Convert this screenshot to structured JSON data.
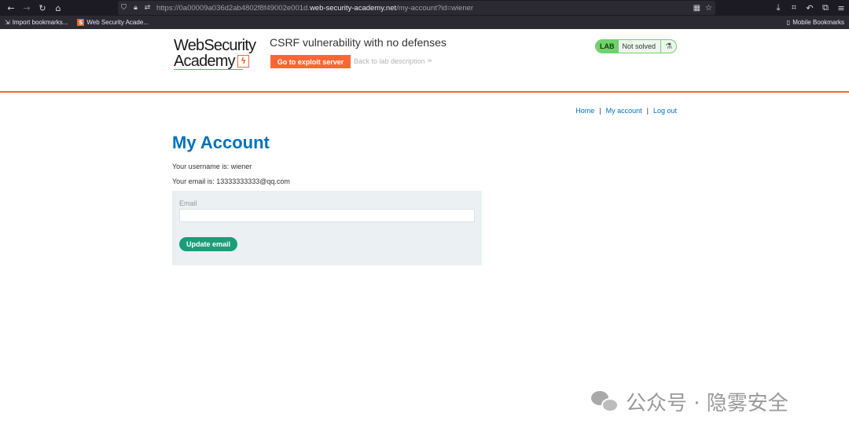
{
  "browser": {
    "url_prefix": "https://0a00009a036d2ab4802f8f49002e001d.",
    "url_host": "web-security-academy.net",
    "url_path": "/my-account?id=wiener",
    "bookmarks": [
      {
        "label": "Import bookmarks..."
      },
      {
        "label": "Web Security Acade..."
      }
    ],
    "mobile_bookmarks": "Mobile Bookmarks"
  },
  "header": {
    "logo_line1": "WebSecurity",
    "logo_line2": "Academy",
    "lab_title": "CSRF vulnerability with no defenses",
    "exploit_button": "Go to exploit server",
    "back_link": "Back to lab description",
    "lab_badge": "LAB",
    "lab_status": "Not solved"
  },
  "nav": {
    "home": "Home",
    "separator": "|",
    "my_account": "My account",
    "log_out": "Log out"
  },
  "account": {
    "title": "My Account",
    "username_line": "Your username is: wiener",
    "email_line": "Your email is: 13333333333@qq.com",
    "email_label": "Email",
    "email_value": "",
    "update_button": "Update email"
  },
  "watermark": {
    "text": "公众号 · 隐雾安全"
  },
  "colors": {
    "accent_orange": "#ff6633",
    "link_blue": "#0071bc",
    "lab_green": "#70d16d",
    "button_green": "#1b9e77",
    "form_bg": "#ebf0f2"
  }
}
